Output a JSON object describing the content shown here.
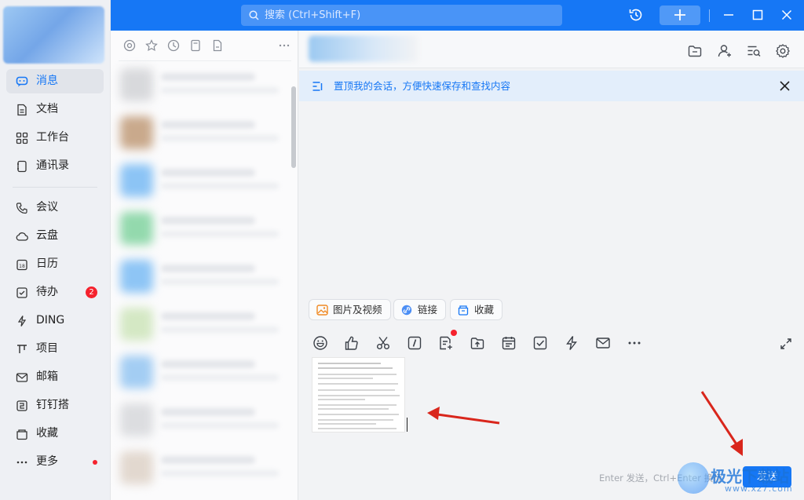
{
  "search": {
    "placeholder": "搜索 (Ctrl+Shift+F)"
  },
  "nav": {
    "items": [
      {
        "label": "消息",
        "icon": "message-icon",
        "active": true
      },
      {
        "label": "文档",
        "icon": "document-icon"
      },
      {
        "label": "工作台",
        "icon": "grid-icon"
      },
      {
        "label": "通讯录",
        "icon": "contacts-icon"
      },
      {
        "label": "会议",
        "icon": "phone-icon"
      },
      {
        "label": "云盘",
        "icon": "cloud-icon"
      },
      {
        "label": "日历",
        "icon": "calendar-icon"
      },
      {
        "label": "待办",
        "icon": "todo-icon",
        "badge": "2"
      },
      {
        "label": "DING",
        "icon": "lightning-icon"
      },
      {
        "label": "项目",
        "icon": "project-icon"
      },
      {
        "label": "邮箱",
        "icon": "mail-icon"
      },
      {
        "label": "钉钉搭",
        "icon": "build-icon"
      },
      {
        "label": "收藏",
        "icon": "favorite-icon"
      },
      {
        "label": "更多",
        "icon": "more-icon",
        "dot": true
      }
    ]
  },
  "pinbar": {
    "text": "置顶我的会话，方便快速保存和查找内容"
  },
  "quick_actions": {
    "media": "图片及视频",
    "link": "链接",
    "favorite": "收藏"
  },
  "composer": {
    "hint": "Enter 发送，Ctrl+Enter 换行",
    "send": "发送"
  },
  "colors": {
    "accent": "#1677f5",
    "badge": "#f5222d",
    "arrow": "#d9261c"
  },
  "watermark": {
    "text": "极光下载站",
    "url": "www.xz7.com"
  }
}
